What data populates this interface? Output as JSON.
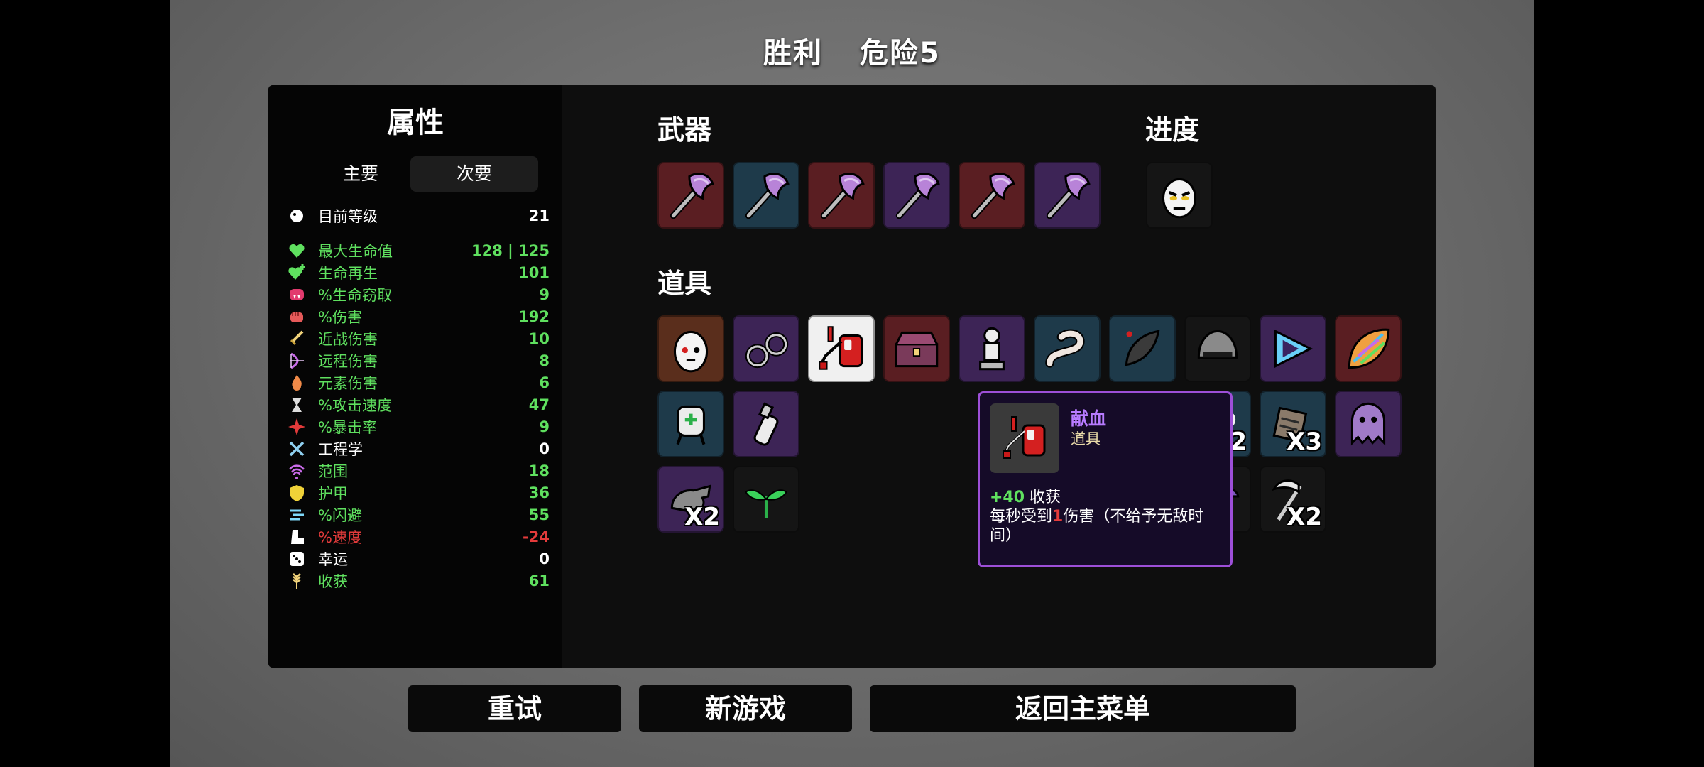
{
  "header": {
    "result": "胜利",
    "danger": "危险5"
  },
  "stats": {
    "title": "属性",
    "tabs": {
      "primary": "主要",
      "secondary": "次要"
    },
    "rows": [
      {
        "icon": "level-icon",
        "name": "目前等级",
        "value": "21",
        "color": "white"
      },
      {
        "icon": "heart-icon",
        "name": "最大生命值",
        "value": "128 | 125",
        "color": "green"
      },
      {
        "icon": "heart-plus-icon",
        "name": "生命再生",
        "value": "101",
        "color": "green"
      },
      {
        "icon": "fangs-icon",
        "name": "%生命窃取",
        "value": "9",
        "color": "green"
      },
      {
        "icon": "fist-icon",
        "name": "%伤害",
        "value": "192",
        "color": "green"
      },
      {
        "icon": "sword-icon",
        "name": "近战伤害",
        "value": "10",
        "color": "green"
      },
      {
        "icon": "bow-icon",
        "name": "远程伤害",
        "value": "8",
        "color": "green"
      },
      {
        "icon": "flame-icon",
        "name": "元素伤害",
        "value": "6",
        "color": "green"
      },
      {
        "icon": "hourglass-icon",
        "name": "%攻击速度",
        "value": "47",
        "color": "green"
      },
      {
        "icon": "crit-icon",
        "name": "%暴击率",
        "value": "9",
        "color": "green"
      },
      {
        "icon": "wrench-icon",
        "name": "工程学",
        "value": "0",
        "color": "white"
      },
      {
        "icon": "range-icon",
        "name": "范围",
        "value": "18",
        "color": "green"
      },
      {
        "icon": "shield-icon",
        "name": "护甲",
        "value": "36",
        "color": "green"
      },
      {
        "icon": "dodge-icon",
        "name": "%闪避",
        "value": "55",
        "color": "green"
      },
      {
        "icon": "boot-icon",
        "name": "%速度",
        "value": "-24",
        "color": "red"
      },
      {
        "icon": "dice-icon",
        "name": "幸运",
        "value": "0",
        "color": "white"
      },
      {
        "icon": "wheat-icon",
        "name": "收获",
        "value": "61",
        "color": "green"
      }
    ]
  },
  "weapons": {
    "title": "武器",
    "items": [
      {
        "icon": "axe-icon",
        "tier": "red"
      },
      {
        "icon": "axe-icon",
        "tier": "blue"
      },
      {
        "icon": "axe-icon",
        "tier": "red"
      },
      {
        "icon": "axe-icon",
        "tier": "purple"
      },
      {
        "icon": "axe-icon",
        "tier": "red"
      },
      {
        "icon": "axe-icon",
        "tier": "purple"
      }
    ]
  },
  "progress": {
    "title": "进度",
    "items": [
      {
        "icon": "angry-egg-icon",
        "tier": "black"
      }
    ]
  },
  "items": {
    "title": "道具",
    "grid": [
      {
        "icon": "egg-face-icon",
        "tier": "orange",
        "count": ""
      },
      {
        "icon": "handcuffs-icon",
        "tier": "purple",
        "count": ""
      },
      {
        "icon": "blood-bag-icon",
        "tier": "white",
        "count": ""
      },
      {
        "icon": "treasure-chest-icon",
        "tier": "red",
        "count": ""
      },
      {
        "icon": "statue-icon",
        "tier": "purple",
        "count": ""
      },
      {
        "icon": "worm-icon",
        "tier": "blue",
        "count": ""
      },
      {
        "icon": "leech-icon",
        "tier": "blue",
        "count": ""
      },
      {
        "icon": "helmet-icon",
        "tier": "black",
        "count": ""
      },
      {
        "icon": "triangle-gem-icon",
        "tier": "purple",
        "count": ""
      },
      {
        "icon": "rainbow-leaf-icon",
        "tier": "red",
        "count": ""
      },
      {
        "icon": "medic-robot-icon",
        "tier": "blue",
        "count": ""
      },
      {
        "icon": "bottle-icon",
        "tier": "purple",
        "count": ""
      },
      {
        "icon": "claw-icon",
        "tier": "purple",
        "count": ""
      },
      {
        "icon": "boxing-glove-icon",
        "tier": "black",
        "count": ""
      },
      {
        "icon": "eyes-icon",
        "tier": "blue",
        "count": "X2"
      },
      {
        "icon": "scroll-icon",
        "tier": "blue",
        "count": "X3"
      },
      {
        "icon": "ghost-icon",
        "tier": "purple",
        "count": ""
      },
      {
        "icon": "turret-icon",
        "tier": "purple",
        "count": "X2"
      },
      {
        "icon": "sprout-icon",
        "tier": "black",
        "count": ""
      },
      {
        "icon": "skull-icon",
        "tier": "black",
        "count": ""
      },
      {
        "icon": "rabbit-icon",
        "tier": "blue",
        "count": "X2"
      },
      {
        "icon": "mushroom-icon",
        "tier": "black",
        "count": ""
      },
      {
        "icon": "scythe-icon",
        "tier": "black",
        "count": "X2"
      }
    ]
  },
  "tooltip": {
    "name": "献血",
    "type": "道具",
    "effect1_bonus": "+40",
    "effect1_text": " 收获",
    "effect2_prefix": "每秒受到",
    "effect2_dmg": "1",
    "effect2_suffix": "伤害（不给予无敌时间）"
  },
  "buttons": {
    "retry": "重试",
    "new_game": "新游戏",
    "main_menu": "返回主菜单"
  },
  "colors": {
    "green": "#5fe05f",
    "red": "#e43b3b",
    "tooltip_border": "#9d4fd8",
    "item_name": "#b77bff"
  }
}
